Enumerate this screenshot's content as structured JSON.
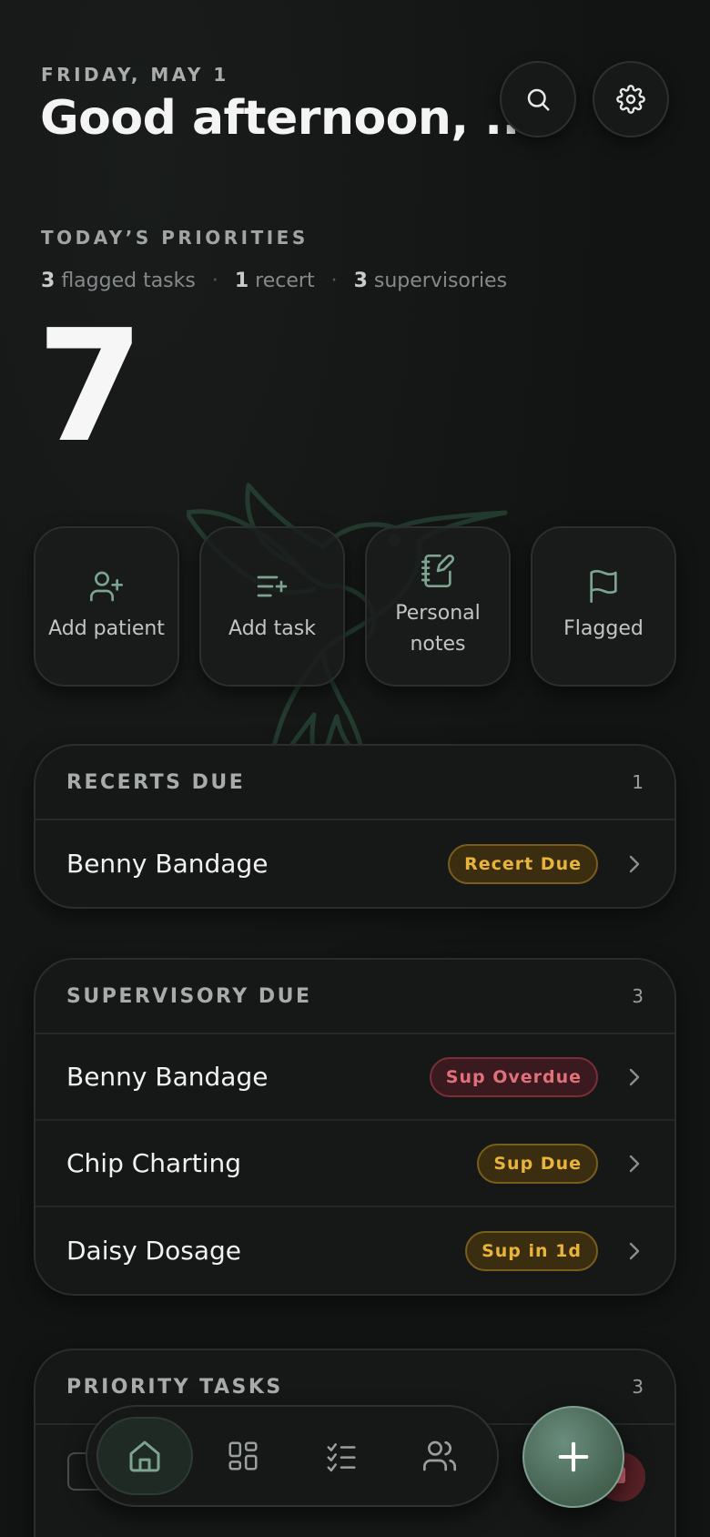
{
  "header": {
    "date": "FRIDAY, MAY 1",
    "greeting": "Good afternoon, ..."
  },
  "priorities": {
    "label": "TODAY’S PRIORITIES",
    "flagged_count": "3",
    "flagged_label": "flagged tasks",
    "recert_count": "1",
    "recert_label": "recert",
    "sup_count": "3",
    "sup_label": "supervisories",
    "total": "7"
  },
  "quick_actions": [
    {
      "label": "Add patient",
      "icon": "user-plus-icon"
    },
    {
      "label": "Add task",
      "icon": "list-plus-icon"
    },
    {
      "label": "Personal notes",
      "icon": "notebook-pen-icon"
    },
    {
      "label": "Flagged",
      "icon": "flag-icon"
    }
  ],
  "recerts": {
    "title": "RECERTS DUE",
    "count": "1",
    "rows": [
      {
        "name": "Benny Bandage",
        "badge": "Recert Due"
      }
    ]
  },
  "supervisory": {
    "title": "SUPERVISORY DUE",
    "count": "3",
    "rows": [
      {
        "name": "Benny Bandage",
        "badge": "Sup Overdue"
      },
      {
        "name": "Chip Charting",
        "badge": "Sup Due"
      },
      {
        "name": "Daisy Dosage",
        "badge": "Sup in 1d"
      }
    ]
  },
  "priority_tasks": {
    "title": "PRIORITY TASKS",
    "count": "3"
  },
  "nav": [
    {
      "icon": "home-icon",
      "active": true
    },
    {
      "icon": "grid-icon",
      "active": false
    },
    {
      "icon": "checklist-icon",
      "active": false
    },
    {
      "icon": "users-icon",
      "active": false
    }
  ],
  "colors": {
    "accent": "#5f8a78",
    "amber": "#e9b43a",
    "red": "#e0707c"
  }
}
